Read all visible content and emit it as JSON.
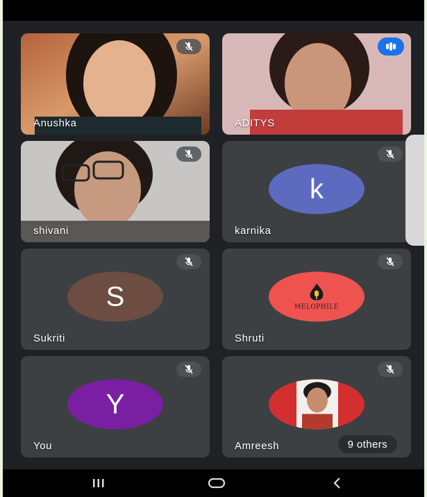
{
  "participants": [
    {
      "name": "Anushka",
      "kind": "video",
      "muted": true
    },
    {
      "name": "ADITYS",
      "kind": "video",
      "speaking": true
    },
    {
      "name": "shivani",
      "kind": "video",
      "muted": true
    },
    {
      "name": "karnika",
      "kind": "avatar",
      "initial": "k",
      "avatar_color": "#5c6bc0",
      "muted": true
    },
    {
      "name": "Sukriti",
      "kind": "avatar",
      "initial": "S",
      "avatar_color": "#6d4c41",
      "muted": true
    },
    {
      "name": "Shruti",
      "kind": "avatar-logo",
      "logo_text": "MELOPHILE",
      "avatar_color": "#ef5350",
      "muted": true
    },
    {
      "name": "You",
      "kind": "avatar",
      "initial": "Y",
      "avatar_color": "#7b1fa2",
      "muted": true
    },
    {
      "name": "Amreesh",
      "kind": "avatar-photo",
      "avatar_color": "#d32f2f",
      "muted": true
    }
  ],
  "overflow": {
    "label": "9 others"
  },
  "icons": {
    "mute": "mic-off-icon",
    "speaking": "audio-level-icon",
    "nav_recents": "recents-icon",
    "nav_home": "home-icon",
    "nav_back": "back-icon"
  },
  "colors": {
    "background": "#202124",
    "tile": "#3c4043",
    "speaking_badge": "#1a73e8"
  }
}
